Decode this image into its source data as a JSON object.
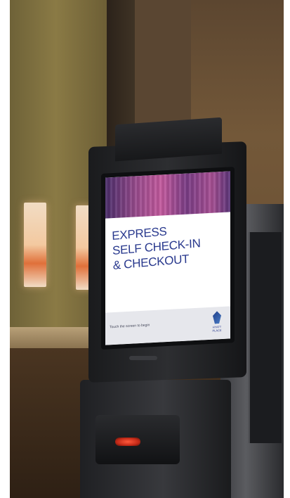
{
  "scene": {
    "kiosk_screen": {
      "title_lines": [
        "EXPRESS",
        "SELF CHECK-IN",
        "& CHECKOUT"
      ],
      "footer_text": "Touch the screen to begin",
      "brand_text": "HYATT PLACE",
      "brand_icon": "hotel-logo-icon",
      "colors": {
        "title": "#2a3a8e",
        "header_accent": "#c45a9e"
      }
    },
    "card_reader_light_color": "#ff5a3c"
  }
}
